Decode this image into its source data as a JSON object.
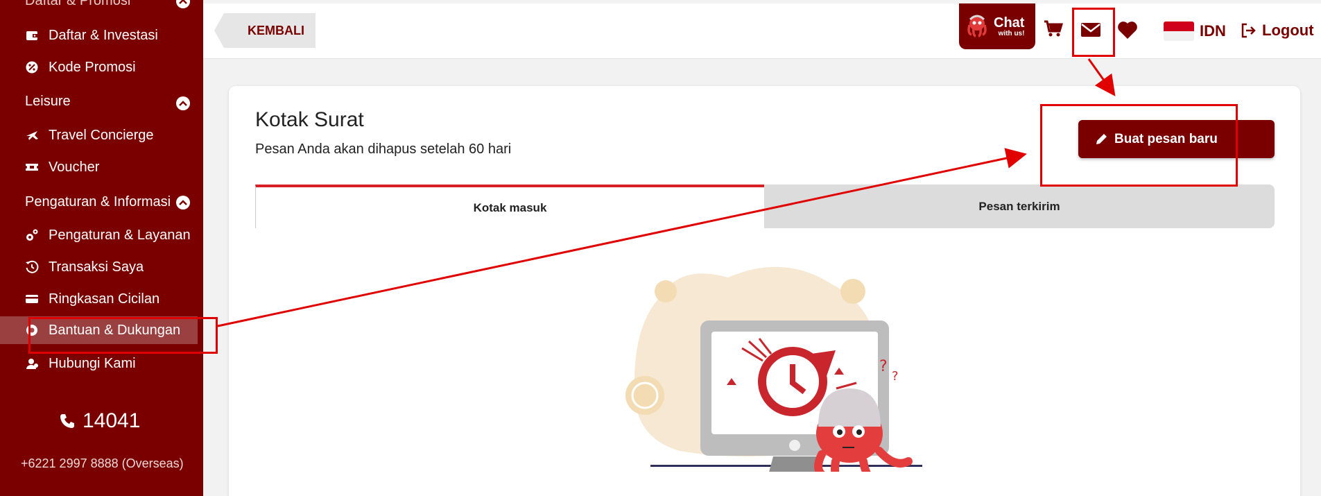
{
  "sidebar": {
    "top_cut_label": "Daftar & Promosi",
    "items_a": [
      {
        "label": "Daftar & Investasi",
        "icon": "wallet-icon"
      },
      {
        "label": "Kode Promosi",
        "icon": "promo-icon"
      }
    ],
    "section_leisure": "Leisure",
    "items_b": [
      {
        "label": "Travel Concierge",
        "icon": "plane-icon"
      },
      {
        "label": "Voucher",
        "icon": "ticket-icon"
      }
    ],
    "section_settings": "Pengaturan & Informasi",
    "items_c": [
      {
        "label": "Pengaturan & Layanan",
        "icon": "gears-icon"
      },
      {
        "label": "Transaksi Saya",
        "icon": "history-icon"
      },
      {
        "label": "Ringkasan Cicilan",
        "icon": "card-icon"
      },
      {
        "label": "Bantuan & Dukungan",
        "icon": "help-icon"
      },
      {
        "label": "Hubungi Kami",
        "icon": "contact-icon"
      }
    ],
    "phone": "14041",
    "overseas": "+6221 2997 8888 (Overseas)"
  },
  "header": {
    "back_label": "KEMBALI",
    "chat_title": "Chat",
    "chat_sub": "with us!",
    "language": "IDN",
    "logout_label": "Logout"
  },
  "main": {
    "title": "Kotak Surat",
    "subtitle": "Pesan Anda akan dihapus setelah 60 hari",
    "new_message_label": "Buat pesan baru",
    "tabs": [
      {
        "label": "Kotak masuk",
        "active": true
      },
      {
        "label": "Pesan terkirim",
        "active": false
      }
    ]
  },
  "colors": {
    "brand": "#7a0000",
    "accent_red": "#d91f26",
    "annotation": "#e00000"
  }
}
